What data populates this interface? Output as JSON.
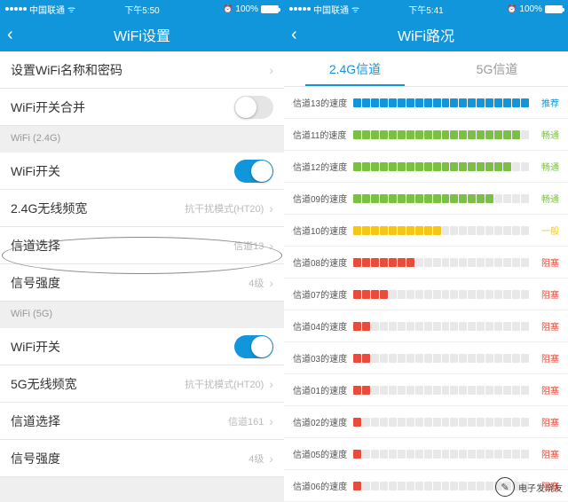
{
  "left": {
    "statusbar": {
      "carrier": "中国联通",
      "time": "下午5:50",
      "battery": "100%"
    },
    "title": "WiFi设置",
    "rows": {
      "name_pwd": "设置WiFi名称和密码",
      "merge": "WiFi开关合并",
      "sec24": "WiFi (2.4G)",
      "switch24": "WiFi开关",
      "bw24": "2.4G无线频宽",
      "bw24_val": "抗干扰模式(HT20)",
      "ch24": "信道选择",
      "ch24_val": "信道13",
      "sig24": "信号强度",
      "sig24_val": "4级",
      "sec5": "WiFi (5G)",
      "switch5": "WiFi开关",
      "bw5": "5G无线频宽",
      "bw5_val": "抗干扰模式(HT20)",
      "ch5": "信道选择",
      "ch5_val": "信道161",
      "sig5": "信号强度",
      "sig5_val": "4级"
    }
  },
  "right": {
    "statusbar": {
      "carrier": "中国联通",
      "time": "下午5:41",
      "battery": "100%"
    },
    "title": "WiFi路况",
    "tabs": {
      "t24": "2.4G信道",
      "t5": "5G信道"
    },
    "status_labels": {
      "recommend": "推荐",
      "smooth": "畅通",
      "normal": "一般",
      "jam": "阻塞"
    },
    "colors": {
      "recommend": "#1296db",
      "smooth": "#7ac143",
      "normal": "#f5c518",
      "jam": "#e74c3c"
    },
    "channels": [
      {
        "label": "信道13的速度",
        "fill": 20,
        "total": 20,
        "status": "recommend"
      },
      {
        "label": "信道11的速度",
        "fill": 19,
        "total": 20,
        "status": "smooth"
      },
      {
        "label": "信道12的速度",
        "fill": 18,
        "total": 20,
        "status": "smooth"
      },
      {
        "label": "信道09的速度",
        "fill": 16,
        "total": 20,
        "status": "smooth"
      },
      {
        "label": "信道10的速度",
        "fill": 10,
        "total": 20,
        "status": "normal"
      },
      {
        "label": "信道08的速度",
        "fill": 7,
        "total": 20,
        "status": "jam"
      },
      {
        "label": "信道07的速度",
        "fill": 4,
        "total": 20,
        "status": "jam"
      },
      {
        "label": "信道04的速度",
        "fill": 2,
        "total": 20,
        "status": "jam"
      },
      {
        "label": "信道03的速度",
        "fill": 2,
        "total": 20,
        "status": "jam"
      },
      {
        "label": "信道01的速度",
        "fill": 2,
        "total": 20,
        "status": "jam"
      },
      {
        "label": "信道02的速度",
        "fill": 1,
        "total": 20,
        "status": "jam"
      },
      {
        "label": "信道05的速度",
        "fill": 1,
        "total": 20,
        "status": "jam"
      },
      {
        "label": "信道06的速度",
        "fill": 1,
        "total": 20,
        "status": "jam"
      }
    ]
  },
  "watermark": "电子发烧友"
}
